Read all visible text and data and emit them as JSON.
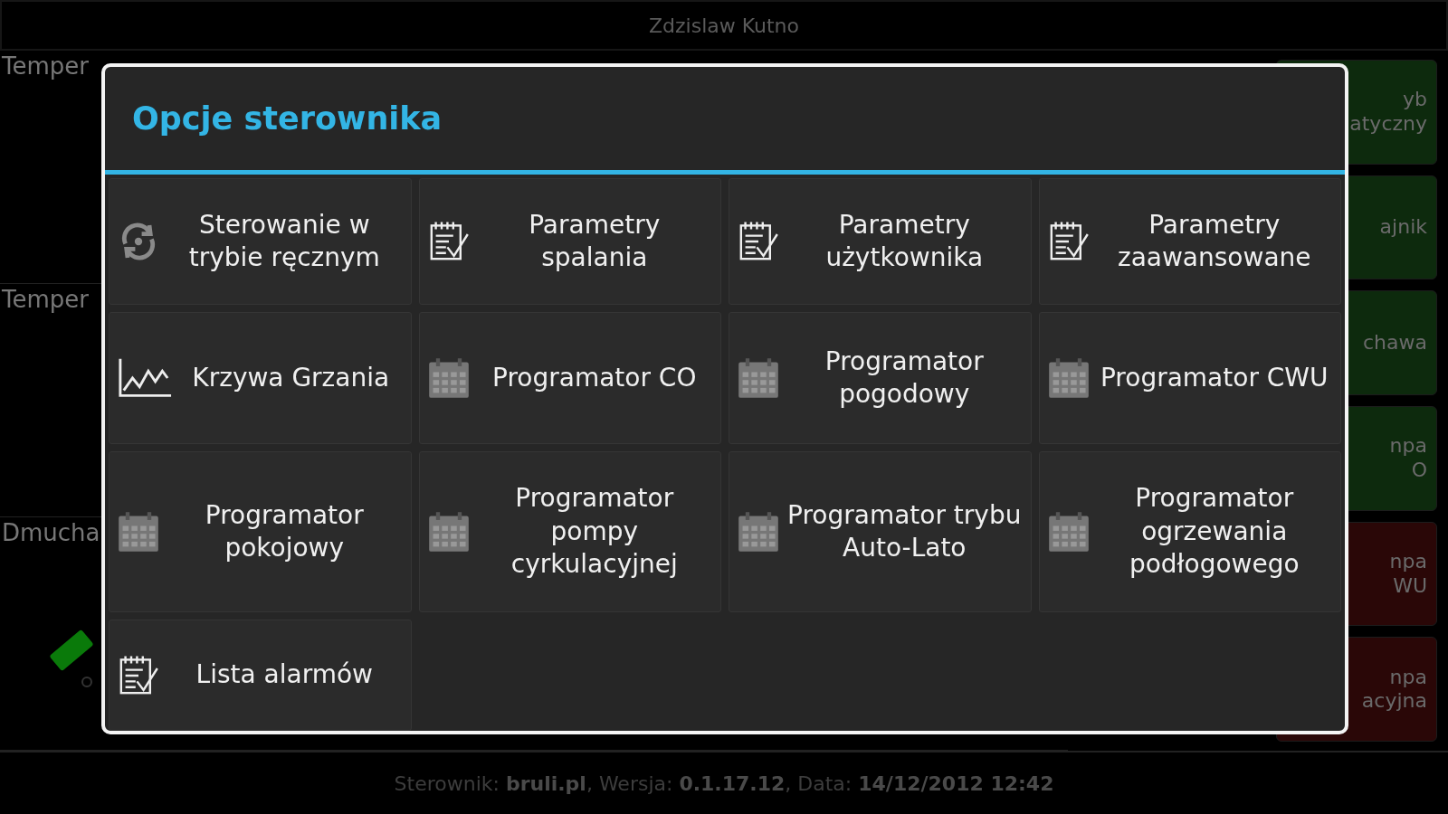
{
  "title_bar": {
    "title": "Zdzislaw  Kutno"
  },
  "left_panels": [
    {
      "label": "Temper"
    },
    {
      "label": "Temper"
    },
    {
      "label": "Dmucha"
    }
  ],
  "right_buttons": [
    {
      "lines": [
        "yb",
        "atyczny"
      ],
      "color": "#0d2a0d"
    },
    {
      "lines": [
        "ajnik"
      ],
      "color": "#0d2a0d"
    },
    {
      "lines": [
        "chawa"
      ],
      "color": "#0d2a0d"
    },
    {
      "lines": [
        "npa",
        "O"
      ],
      "color": "#0d2a0d"
    },
    {
      "lines": [
        "npa",
        "WU"
      ],
      "color": "#2a0707"
    },
    {
      "lines": [
        "npa",
        "acyjna"
      ],
      "color": "#2a0707"
    }
  ],
  "status_bar": {
    "text": "Sterownik: **bruli.pl**, Wersja: **0.1.17.12**, Data: **14/12/2012 12:42**"
  },
  "dialog": {
    "title": "Opcje sterownika",
    "items": [
      {
        "kind": "refresh",
        "label": "Sterowanie w trybie ręcznym"
      },
      {
        "kind": "notepad",
        "label": "Parametry spalania"
      },
      {
        "kind": "notepad",
        "label": "Parametry użytkownika"
      },
      {
        "kind": "notepad",
        "label": "Parametry zaawansowane"
      },
      {
        "kind": "chart",
        "label": "Krzywa Grzania"
      },
      {
        "kind": "calendar",
        "label": "Programator CO"
      },
      {
        "kind": "calendar",
        "label": "Programator pogodowy"
      },
      {
        "kind": "calendar",
        "label": "Programator CWU"
      },
      {
        "kind": "calendar",
        "label": "Programator pokojowy"
      },
      {
        "kind": "calendar",
        "label": "Programator pompy cyrkulacyjnej"
      },
      {
        "kind": "calendar",
        "label": "Programator trybu Auto-Lato"
      },
      {
        "kind": "calendar",
        "label": "Programator ogrzewania podłogowego"
      },
      {
        "kind": "notepad",
        "label": "Lista alarmów"
      }
    ]
  }
}
